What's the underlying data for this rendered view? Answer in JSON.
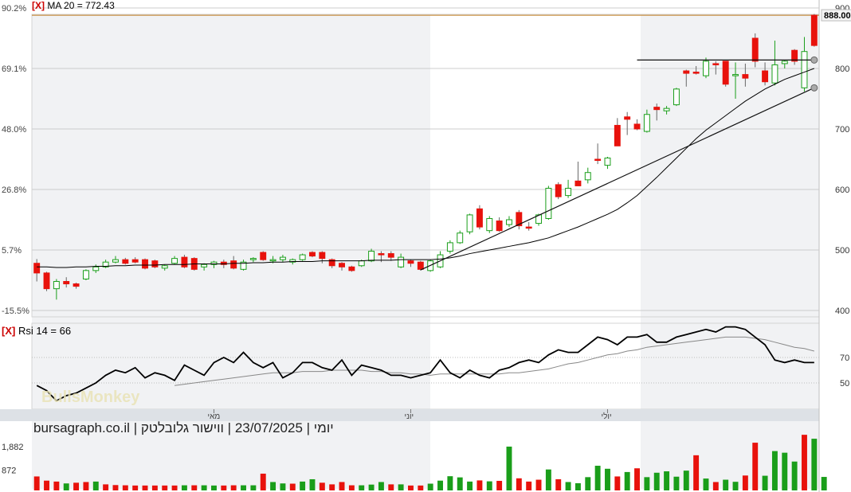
{
  "header": {
    "ma_close": "[X]",
    "ma_label": "MA 20 = 772.43",
    "rsi_close": "[X]",
    "rsi_label": "Rsi 14 = 66",
    "caption": "יומי | 23/07/2025 | ווישור גלובלטק | bursagraph.co.il",
    "watermark": "BullsMonkey"
  },
  "colors": {
    "up": "#1a9e1a",
    "down": "#e8120c",
    "line": "#000000",
    "rsi_signal": "#888888",
    "last_price_line": "#c07a1a",
    "grid": "#cccccc",
    "shade": "#f1f2f4",
    "panel_bar": "#dde1e6"
  },
  "chart_data": [
    {
      "type": "candlestick",
      "title": "MA 20 = 772.43",
      "current_price_label": "888.00",
      "last_price": 888,
      "y_ticks_right": [
        "900",
        "800",
        "700",
        "600",
        "500",
        "400"
      ],
      "y_ticks_right_values": [
        900,
        800,
        700,
        600,
        500,
        400
      ],
      "y_ticks_left": [
        "90.2%",
        "69.1%",
        "48.0%",
        "26.8%",
        "5.7%",
        "-15.5%"
      ],
      "ylim": [
        385,
        910
      ],
      "ohlc": [
        [
          478,
          485,
          448,
          462
        ],
        [
          462,
          464,
          432,
          436
        ],
        [
          436,
          452,
          418,
          448
        ],
        [
          448,
          455,
          438,
          444
        ],
        [
          444,
          446,
          436,
          440
        ],
        [
          452,
          468,
          450,
          466
        ],
        [
          466,
          476,
          462,
          472
        ],
        [
          472,
          484,
          470,
          480
        ],
        [
          480,
          490,
          478,
          484
        ],
        [
          484,
          487,
          476,
          478
        ],
        [
          484,
          488,
          478,
          480
        ],
        [
          484,
          486,
          468,
          470
        ],
        [
          482,
          484,
          470,
          472
        ],
        [
          470,
          476,
          466,
          474
        ],
        [
          478,
          490,
          476,
          486
        ],
        [
          488,
          492,
          470,
          472
        ],
        [
          486,
          488,
          466,
          468
        ],
        [
          472,
          478,
          466,
          476
        ],
        [
          476,
          482,
          470,
          480
        ],
        [
          480,
          484,
          470,
          476
        ],
        [
          482,
          490,
          468,
          470
        ],
        [
          468,
          484,
          466,
          480
        ],
        [
          484,
          488,
          480,
          486
        ],
        [
          496,
          498,
          482,
          484
        ],
        [
          482,
          490,
          478,
          484
        ],
        [
          484,
          492,
          480,
          488
        ],
        [
          480,
          486,
          476,
          484
        ],
        [
          484,
          494,
          482,
          492
        ],
        [
          496,
          498,
          488,
          490
        ],
        [
          496,
          498,
          478,
          486
        ],
        [
          484,
          486,
          470,
          474
        ],
        [
          478,
          480,
          466,
          472
        ],
        [
          472,
          474,
          464,
          466
        ],
        [
          474,
          484,
          472,
          482
        ],
        [
          482,
          502,
          480,
          498
        ],
        [
          494,
          498,
          480,
          492
        ],
        [
          494,
          498,
          482,
          488
        ],
        [
          472,
          494,
          470,
          488
        ],
        [
          482,
          484,
          472,
          478
        ],
        [
          480,
          482,
          466,
          468
        ],
        [
          466,
          484,
          464,
          482
        ],
        [
          472,
          498,
          470,
          492
        ],
        [
          498,
          516,
          494,
          512
        ],
        [
          512,
          532,
          510,
          528
        ],
        [
          530,
          560,
          526,
          558
        ],
        [
          568,
          574,
          534,
          538
        ],
        [
          532,
          556,
          528,
          552
        ],
        [
          548,
          554,
          530,
          532
        ],
        [
          542,
          556,
          538,
          550
        ],
        [
          562,
          566,
          534,
          540
        ],
        [
          538,
          546,
          532,
          536
        ],
        [
          544,
          560,
          540,
          558
        ],
        [
          552,
          606,
          550,
          602
        ],
        [
          608,
          612,
          584,
          588
        ],
        [
          590,
          616,
          586,
          602
        ],
        [
          614,
          646,
          608,
          606
        ],
        [
          616,
          636,
          610,
          628
        ],
        [
          650,
          676,
          642,
          648
        ],
        [
          640,
          654,
          634,
          652
        ],
        [
          706,
          718,
          676,
          672
        ],
        [
          720,
          728,
          690,
          716
        ],
        [
          708,
          716,
          698,
          700
        ],
        [
          696,
          732,
          694,
          724
        ],
        [
          736,
          742,
          714,
          732
        ],
        [
          730,
          738,
          724,
          734
        ],
        [
          740,
          768,
          738,
          766
        ],
        [
          796,
          798,
          770,
          792
        ],
        [
          794,
          804,
          790,
          792
        ],
        [
          788,
          818,
          784,
          812
        ],
        [
          808,
          812,
          790,
          806
        ],
        [
          812,
          812,
          770,
          774
        ],
        [
          788,
          810,
          750,
          790
        ],
        [
          790,
          808,
          770,
          784
        ],
        [
          850,
          858,
          802,
          812
        ],
        [
          796,
          810,
          772,
          778
        ],
        [
          776,
          846,
          772,
          806
        ],
        [
          808,
          814,
          800,
          812
        ],
        [
          830,
          832,
          806,
          812
        ],
        [
          768,
          852,
          762,
          828
        ],
        [
          888,
          890,
          836,
          838
        ]
      ],
      "ma20": [
        472,
        472,
        471,
        471,
        472,
        472,
        473,
        473,
        474,
        474,
        475,
        475,
        475,
        476,
        476,
        476,
        477,
        477,
        477,
        477,
        478,
        478,
        479,
        479,
        480,
        480,
        481,
        481,
        481,
        482,
        482,
        482,
        482,
        482,
        483,
        483,
        483,
        484,
        484,
        484,
        484,
        485,
        487,
        490,
        494,
        497,
        500,
        503,
        506,
        509,
        512,
        516,
        520,
        526,
        532,
        538,
        545,
        552,
        559,
        567,
        578,
        590,
        605,
        620,
        636,
        652,
        668,
        684,
        698,
        710,
        722,
        734,
        746,
        756,
        766,
        774,
        782,
        788,
        794,
        800
      ],
      "trendlines": [
        {
          "from": [
            39,
            467
          ],
          "to": [
            79,
            768
          ]
        },
        {
          "from": [
            61,
            814
          ],
          "to": [
            79,
            814
          ]
        }
      ],
      "month_labels": [
        "מאי",
        "יוני",
        "יולי"
      ]
    },
    {
      "type": "line",
      "title": "Rsi 14 = 66",
      "y_ticks_right": [
        "70",
        "50"
      ],
      "y_ticks_right_values": [
        70,
        50
      ],
      "ylim": [
        30,
        100
      ],
      "rsi": [
        48,
        44,
        36,
        40,
        42,
        46,
        50,
        56,
        60,
        58,
        62,
        54,
        58,
        56,
        52,
        64,
        60,
        56,
        66,
        70,
        66,
        74,
        66,
        62,
        66,
        54,
        58,
        66,
        66,
        62,
        60,
        68,
        56,
        64,
        62,
        60,
        56,
        56,
        54,
        56,
        58,
        68,
        58,
        54,
        60,
        56,
        54,
        60,
        62,
        66,
        68,
        66,
        72,
        76,
        74,
        74,
        80,
        86,
        84,
        80,
        86,
        86,
        88,
        82,
        82,
        86,
        88,
        90,
        92,
        90,
        94,
        94,
        92,
        86,
        80,
        68,
        66,
        68,
        66,
        66
      ],
      "rsi_signal": [
        null,
        null,
        null,
        null,
        null,
        null,
        null,
        null,
        null,
        null,
        null,
        null,
        null,
        null,
        48,
        49,
        50,
        51,
        52,
        53,
        54,
        55,
        56,
        57,
        58,
        58,
        58,
        59,
        59,
        59,
        60,
        60,
        60,
        60,
        59,
        59,
        58,
        58,
        57,
        57,
        56,
        57,
        57,
        57,
        57,
        57,
        57,
        57,
        58,
        58,
        59,
        60,
        61,
        63,
        65,
        66,
        68,
        70,
        72,
        73,
        75,
        76,
        78,
        79,
        80,
        81,
        82,
        83,
        84,
        85,
        86,
        86,
        86,
        85,
        84,
        82,
        80,
        78,
        77,
        75
      ]
    },
    {
      "type": "bar",
      "title": "",
      "y_ticks_left": [
        "1,882",
        "872"
      ],
      "y_ticks_left_values": [
        1882,
        872
      ],
      "ylim": [
        0,
        2600
      ],
      "volume": [
        600,
        420,
        380,
        300,
        330,
        360,
        380,
        260,
        230,
        220,
        210,
        210,
        210,
        210,
        210,
        220,
        220,
        220,
        210,
        210,
        220,
        220,
        220,
        720,
        360,
        300,
        290,
        380,
        480,
        330,
        260,
        360,
        220,
        220,
        250,
        360,
        260,
        260,
        210,
        210,
        290,
        420,
        610,
        560,
        380,
        430,
        390,
        410,
        1882,
        520,
        380,
        460,
        900,
        480,
        360,
        310,
        570,
        1060,
        930,
        600,
        790,
        950,
        570,
        760,
        820,
        590,
        850,
        1510,
        510,
        360,
        460,
        370,
        640,
        2050,
        630,
        1690,
        1620,
        1240,
        2390,
        2220,
        580
      ],
      "volume_colors": [
        "d",
        "d",
        "d",
        "u",
        "d",
        "d",
        "u",
        "d",
        "d",
        "d",
        "d",
        "d",
        "d",
        "d",
        "d",
        "u",
        "d",
        "u",
        "u",
        "d",
        "d",
        "u",
        "u",
        "d",
        "u",
        "u",
        "d",
        "u",
        "u",
        "d",
        "d",
        "d",
        "d",
        "u",
        "u",
        "u",
        "d",
        "u",
        "d",
        "d",
        "u",
        "u",
        "u",
        "u",
        "u",
        "d",
        "u",
        "d",
        "u",
        "d",
        "d",
        "d",
        "u",
        "d",
        "u",
        "u",
        "u",
        "u",
        "u",
        "d",
        "u",
        "d",
        "u",
        "u",
        "u",
        "u",
        "u",
        "d",
        "u",
        "d",
        "u",
        "u",
        "d",
        "d",
        "u",
        "u",
        "u",
        "u",
        "d",
        "u",
        "u"
      ]
    }
  ]
}
